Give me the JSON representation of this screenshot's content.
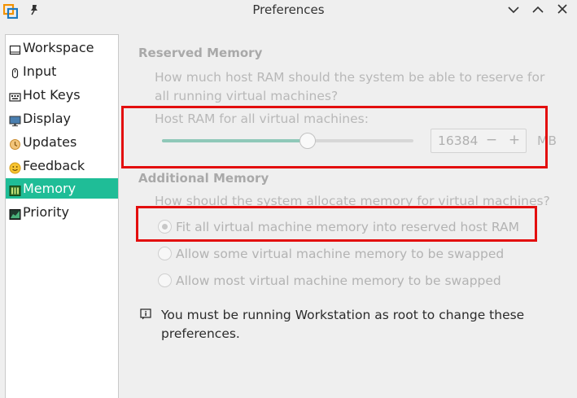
{
  "window": {
    "title": "Preferences",
    "icons": {
      "app": "vmware-logo-icon",
      "pin": "pin-icon",
      "minimize": "chevron-down-icon",
      "maximize": "chevron-up-icon",
      "close": "close-icon"
    }
  },
  "sidebar": {
    "items": [
      {
        "label": "Workspace",
        "icon": "workspace-icon"
      },
      {
        "label": "Input",
        "icon": "input-icon"
      },
      {
        "label": "Hot Keys",
        "icon": "keyboard-icon"
      },
      {
        "label": "Display",
        "icon": "display-icon"
      },
      {
        "label": "Updates",
        "icon": "updates-icon"
      },
      {
        "label": "Feedback",
        "icon": "smiley-icon"
      },
      {
        "label": "Memory",
        "icon": "memory-icon",
        "selected": true
      },
      {
        "label": "Priority",
        "icon": "priority-icon"
      }
    ],
    "selected_color": "#1fbd97"
  },
  "reserved": {
    "title": "Reserved Memory",
    "question": "How much host RAM should the system be able to reserve for all running virtual machines?",
    "slider_label": "Host RAM for all virtual machines:",
    "slider_fraction": 0.58,
    "value": "16384",
    "minus": "−",
    "plus": "+",
    "unit": "MB"
  },
  "additional": {
    "title": "Additional Memory",
    "question": "How should the system allocate memory for virtual machines?",
    "options": [
      {
        "label": "Fit all virtual machine memory into reserved host RAM",
        "checked": true
      },
      {
        "label": "Allow some virtual machine memory to be swapped",
        "checked": false
      },
      {
        "label": "Allow most virtual machine memory to be swapped",
        "checked": false
      }
    ]
  },
  "notice": {
    "icon": "info-icon",
    "text": "You must be running Workstation as root to change these preferences."
  },
  "highlight_color": "#e30e0e"
}
